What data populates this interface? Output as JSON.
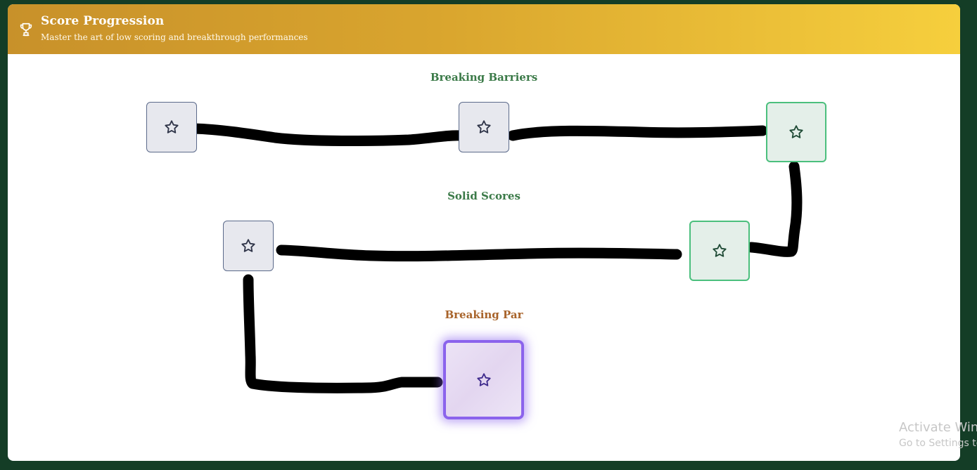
{
  "header": {
    "title": "Score Progression",
    "subtitle": "Master the art of low scoring and breakthrough performances",
    "icon": "trophy-icon"
  },
  "sections": [
    {
      "label": "Breaking Barriers"
    },
    {
      "label": "Solid Scores"
    },
    {
      "label": "Breaking Par"
    }
  ],
  "nodes": [
    {
      "status": "locked",
      "icon": "star-icon"
    },
    {
      "status": "locked",
      "icon": "star-icon"
    },
    {
      "status": "completed",
      "icon": "star-icon"
    },
    {
      "status": "completed",
      "icon": "star-icon"
    },
    {
      "status": "locked",
      "icon": "star-icon"
    },
    {
      "status": "current",
      "icon": "star-icon"
    }
  ],
  "colors": {
    "background": "#143d26",
    "header_start": "#c8912a",
    "header_end": "#f6cf3d",
    "section_green": "#3b7a48",
    "section_orange": "#a8632a",
    "completed_border": "#4bbf7d",
    "current_border": "#8b63ec"
  },
  "watermark": {
    "line1": "Activate Win",
    "line2": "Go to Settings to"
  }
}
